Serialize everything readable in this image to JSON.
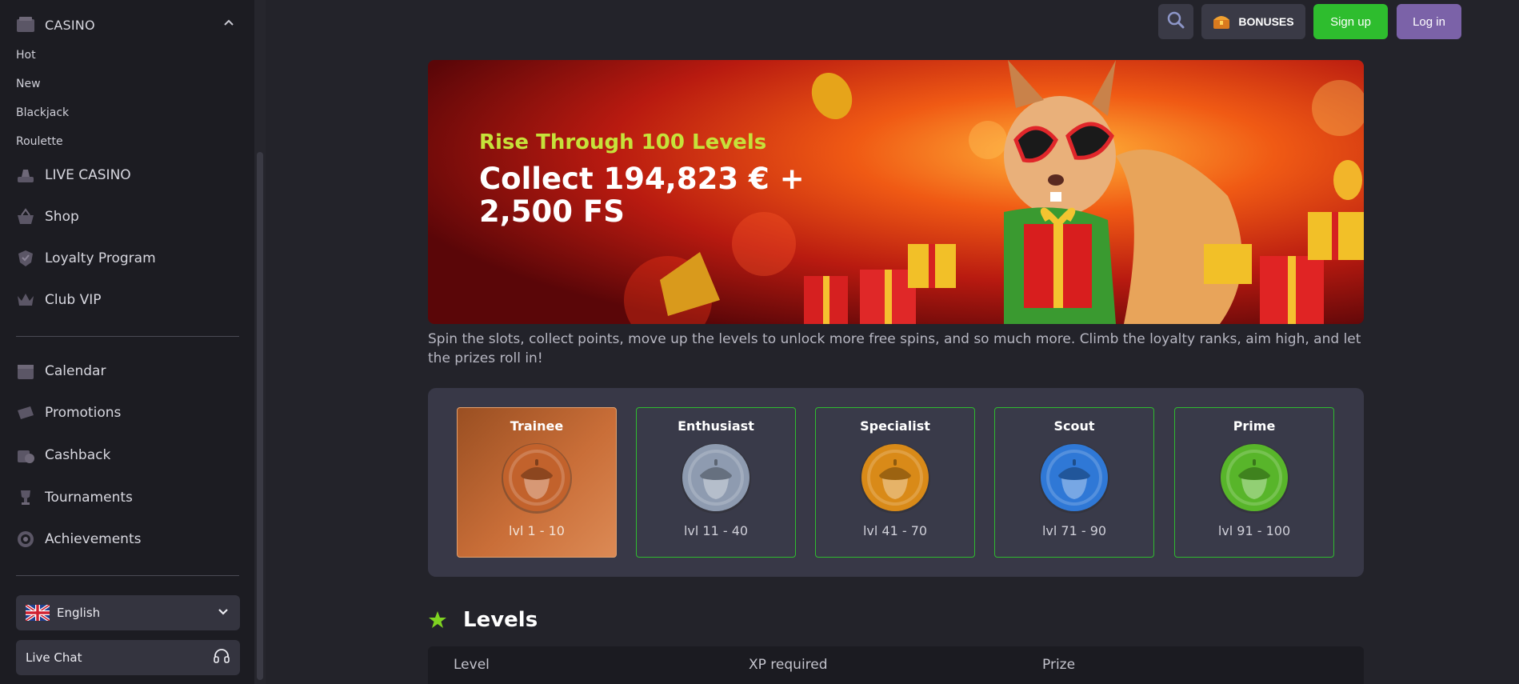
{
  "sidebar": {
    "casino_label": "CASINO",
    "casino_subitems": [
      "Hot",
      "New",
      "Blackjack",
      "Roulette"
    ],
    "main_items": [
      "LIVE CASINO",
      "Shop",
      "Loyalty Program",
      "Club VIP"
    ],
    "secondary_items": [
      "Calendar",
      "Promotions",
      "Cashback",
      "Tournaments",
      "Achievements"
    ],
    "language": "English",
    "live_chat": "Live Chat"
  },
  "topbar": {
    "bonuses": "BONUSES",
    "signup": "Sign up",
    "login": "Log in"
  },
  "banner": {
    "kicker": "Rise Through 100 Levels",
    "headline": "Collect 194,823 € + 2,500 FS"
  },
  "description": "Spin the slots, collect points, move up the levels to unlock more free spins, and so much more. Climb the loyalty ranks, aim high, and let the prizes roll in!",
  "tiers": [
    {
      "name": "Trainee",
      "range": "lvl 1 - 10",
      "color": "#c2622c",
      "active": true
    },
    {
      "name": "Enthusiast",
      "range": "lvl 11 - 40",
      "color": "#8e9bb0",
      "active": false
    },
    {
      "name": "Specialist",
      "range": "lvl 41 - 70",
      "color": "#d98a18",
      "active": false
    },
    {
      "name": "Scout",
      "range": "lvl 71 - 90",
      "color": "#2f78d6",
      "active": false
    },
    {
      "name": "Prime",
      "range": "lvl 91 - 100",
      "color": "#58b52a",
      "active": false
    }
  ],
  "levels": {
    "title": "Levels",
    "columns": [
      "Level",
      "XP required",
      "Prize"
    ]
  },
  "colors": {
    "accent_green": "#2ebd2e",
    "login_purple": "#7b62a8",
    "kicker_lime": "#c6e23a"
  }
}
